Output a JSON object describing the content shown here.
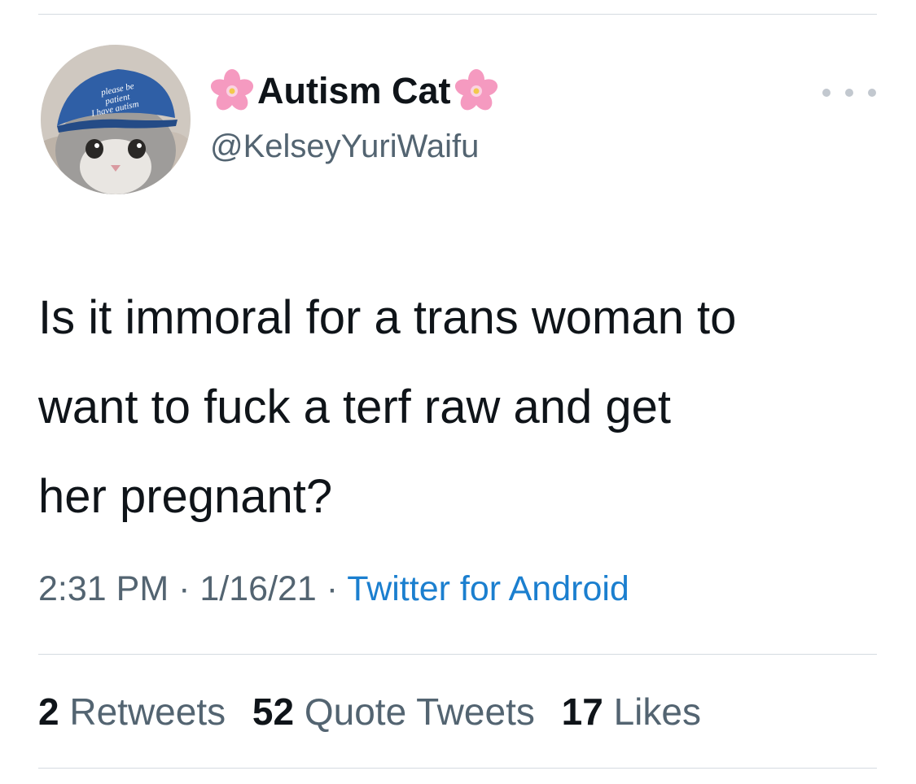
{
  "author": {
    "display_name": "Autism Cat",
    "handle": "@KelseyYuriWaifu",
    "name_emoji": "cherry-blossom-icon",
    "avatar_hat_text": "please be patient I have autism"
  },
  "tweet": {
    "text": "Is it immoral for a trans woman to\nwant to fuck a terf raw and get\nher pregnant?",
    "time": "2:31 PM",
    "date": "1/16/21",
    "separator": "·",
    "source": "Twitter for Android"
  },
  "stats": {
    "retweets_count": "2",
    "retweets_label": "Retweets",
    "quotes_count": "52",
    "quotes_label": "Quote Tweets",
    "likes_count": "17",
    "likes_label": "Likes"
  },
  "colors": {
    "link": "#1b7fcf",
    "secondary_text": "#536471",
    "primary_text": "#0f1419",
    "divider": "#d5dbe1",
    "hat": "#2f5fa6",
    "blossom": "#f59ac0"
  }
}
